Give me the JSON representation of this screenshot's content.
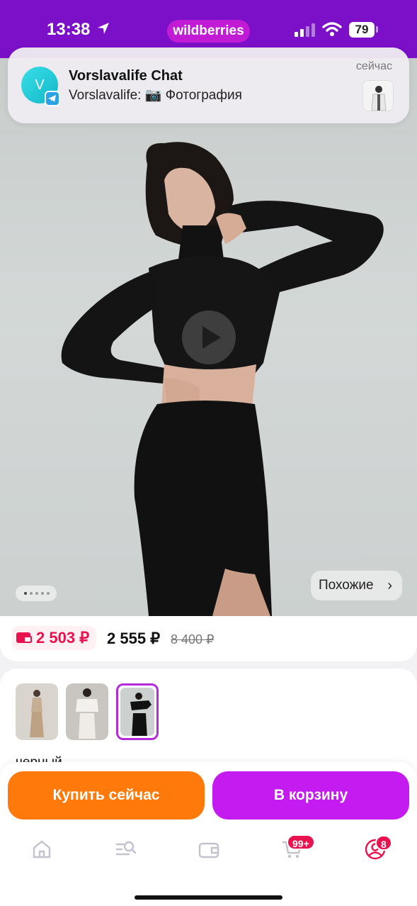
{
  "status_bar": {
    "time": "13:38",
    "brand": "wildberries",
    "battery": "79"
  },
  "notification": {
    "avatar_letter": "V",
    "title": "Vorslavalife Chat",
    "body": "Vorslavalife: 📷 Фотография",
    "time": "сейчас"
  },
  "gallery": {
    "similar_label": "Похожие",
    "video_play_icon": "play-icon"
  },
  "prices": {
    "wallet_price": "2 503 ₽",
    "price": "2 555 ₽",
    "old_price": "8 400 ₽"
  },
  "variants": {
    "color_label": "черный"
  },
  "actions": {
    "buy_now": "Купить сейчас",
    "add_to_cart": "В корзину"
  },
  "tab_bar": {
    "cart_badge": "99+",
    "profile_badge": "8"
  },
  "colors": {
    "brand_purple": "#7b10c8",
    "buy_orange": "#ff7a0a",
    "cart_magenta": "#c31bf0",
    "price_red": "#e8124e"
  }
}
